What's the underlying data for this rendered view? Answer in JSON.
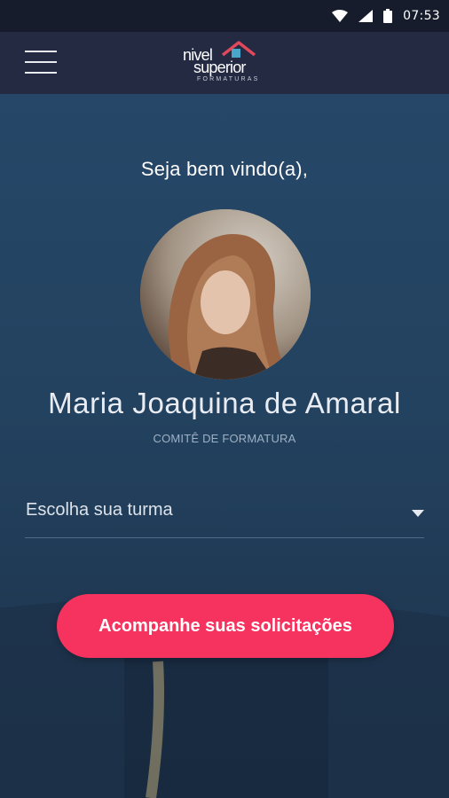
{
  "status_bar": {
    "time": "07:53",
    "icons": [
      "wifi-icon",
      "signal-icon",
      "battery-icon"
    ]
  },
  "app_bar": {
    "menu_icon": "hamburger-menu-icon",
    "logo": {
      "line1": "nivel",
      "line2": "superior",
      "subtitle": "FORMATURAS"
    }
  },
  "main": {
    "welcome": "Seja bem vindo(a),",
    "user": {
      "name": "Maria Joaquina de Amaral",
      "role": "COMITÊ DE FORMATURA"
    },
    "class_select": {
      "label": "Escolha sua turma",
      "arrow_icon": "dropdown-arrow-icon"
    },
    "cta_label": "Acompanhe suas solicitações"
  },
  "colors": {
    "status_bar": "#171c2c",
    "app_bar": "#232a42",
    "background": "#24425f",
    "accent": "#f6325e",
    "logo_roof": "#e0485c",
    "logo_dot": "#4aa6c8"
  }
}
